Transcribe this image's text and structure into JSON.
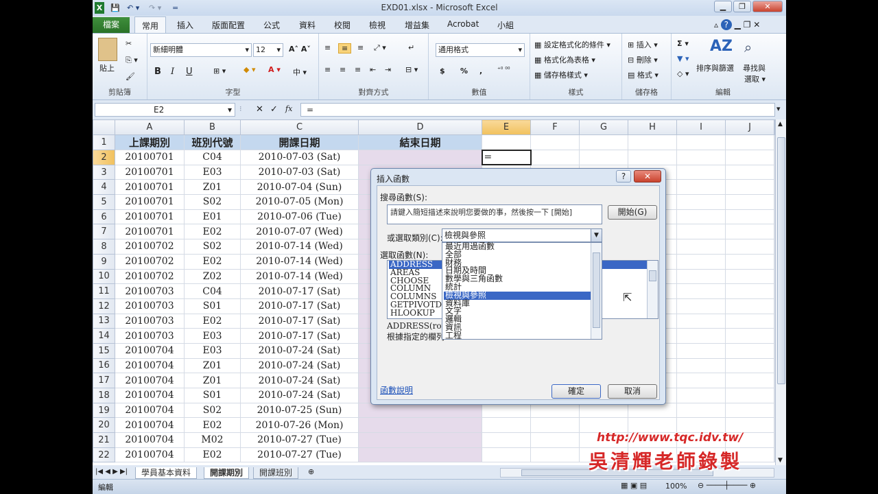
{
  "window": {
    "title": "EXD01.xlsx - Microsoft Excel",
    "minimize_label": "▁",
    "restore_label": "❐",
    "close_label": "✕"
  },
  "quick_access": {
    "excel_logo": "X",
    "save_icon": "💾",
    "undo_label": "↶ ▾",
    "redo_label": "↷ ▾",
    "customize_label": "="
  },
  "tabs": {
    "file": "檔案",
    "items": [
      "常用",
      "插入",
      "版面配置",
      "公式",
      "資料",
      "校閱",
      "檢視",
      "增益集",
      "Acrobat",
      "小組"
    ],
    "active_index": 0
  },
  "ribbon": {
    "clipboard": {
      "label": "剪貼簿",
      "paste": "貼上"
    },
    "font": {
      "label": "字型",
      "name": "新細明體",
      "size": "12",
      "bold": "B",
      "italic": "I",
      "underline": "U"
    },
    "alignment": {
      "label": "對齊方式"
    },
    "number": {
      "label": "數值",
      "format": "通用格式",
      "currency": "$",
      "percent": "%",
      "comma": ","
    },
    "styles": {
      "label": "樣式",
      "cond": "設定格式化的條件",
      "table": "格式化為表格",
      "cell": "儲存格樣式"
    },
    "cells": {
      "label": "儲存格",
      "insert": "插入",
      "delete": "刪除",
      "format": "格式"
    },
    "editing": {
      "label": "編輯",
      "sum": "Σ",
      "sort": "排序與篩選",
      "find": "尋找與",
      "select": "選取"
    }
  },
  "formula_bar": {
    "name_box": "E2",
    "cancel": "✕",
    "enter": "✓",
    "fx": "fx",
    "content": "="
  },
  "sheet": {
    "columns": [
      "A",
      "B",
      "C",
      "D",
      "E",
      "F",
      "G",
      "H",
      "I",
      "J"
    ],
    "header_row": [
      "上課期別",
      "班別代號",
      "開課日期",
      "結束日期"
    ],
    "rows": [
      [
        "20100701",
        "C04",
        "2010-07-03 (Sat)"
      ],
      [
        "20100701",
        "E03",
        "2010-07-03 (Sat)"
      ],
      [
        "20100701",
        "Z01",
        "2010-07-04 (Sun)"
      ],
      [
        "20100701",
        "S02",
        "2010-07-05 (Mon)"
      ],
      [
        "20100701",
        "E01",
        "2010-07-06 (Tue)"
      ],
      [
        "20100701",
        "E02",
        "2010-07-07 (Wed)"
      ],
      [
        "20100702",
        "S02",
        "2010-07-14 (Wed)"
      ],
      [
        "20100702",
        "E02",
        "2010-07-14 (Wed)"
      ],
      [
        "20100702",
        "Z02",
        "2010-07-14 (Wed)"
      ],
      [
        "20100703",
        "C04",
        "2010-07-17 (Sat)"
      ],
      [
        "20100703",
        "S01",
        "2010-07-17 (Sat)"
      ],
      [
        "20100703",
        "E02",
        "2010-07-17 (Sat)"
      ],
      [
        "20100703",
        "E03",
        "2010-07-17 (Sat)"
      ],
      [
        "20100704",
        "E03",
        "2010-07-24 (Sat)"
      ],
      [
        "20100704",
        "Z01",
        "2010-07-24 (Sat)"
      ],
      [
        "20100704",
        "Z01",
        "2010-07-24 (Sat)"
      ],
      [
        "20100704",
        "S01",
        "2010-07-24 (Sat)"
      ],
      [
        "20100704",
        "S02",
        "2010-07-25 (Sun)"
      ],
      [
        "20100704",
        "E02",
        "2010-07-26 (Mon)"
      ],
      [
        "20100704",
        "M02",
        "2010-07-27 (Tue)"
      ],
      [
        "20100704",
        "E02",
        "2010-07-27 (Tue)"
      ]
    ],
    "active_cell_value": "="
  },
  "sheet_tabs": [
    "學員基本資料",
    "開課期別",
    "開課班別"
  ],
  "status": {
    "mode": "編輯",
    "zoom": "100%"
  },
  "dialog": {
    "title": "插入函數",
    "help": "?",
    "close": "✕",
    "search_label": "搜尋函數(S):",
    "search_placeholder": "請鍵入簡短描述來說明您要做的事，然後按一下 [開始]",
    "go_button": "開始(G)",
    "category_label": "或選取類別(C):",
    "category_value": "檢視與參照",
    "category_options": [
      "最近用過函數",
      "全部",
      "財務",
      "日期及時間",
      "數學與三角函數",
      "統計",
      "檢視與參照",
      "資料庫",
      "文字",
      "邏輯",
      "資訊",
      "工程"
    ],
    "category_selected_index": 6,
    "function_label": "選取函數(N):",
    "functions": [
      "ADDRESS",
      "AREAS",
      "CHOOSE",
      "COLUMN",
      "COLUMNS",
      "GETPIVOTDAT",
      "HLOOKUP"
    ],
    "syntax": "ADDRESS(row_n",
    "description": "根據指定的欄列",
    "help_link": "函數說明",
    "ok": "確定",
    "cancel": "取消"
  },
  "watermark": {
    "url": "http://www.tqc.idv.tw/",
    "author": "吳清輝老師錄製"
  }
}
